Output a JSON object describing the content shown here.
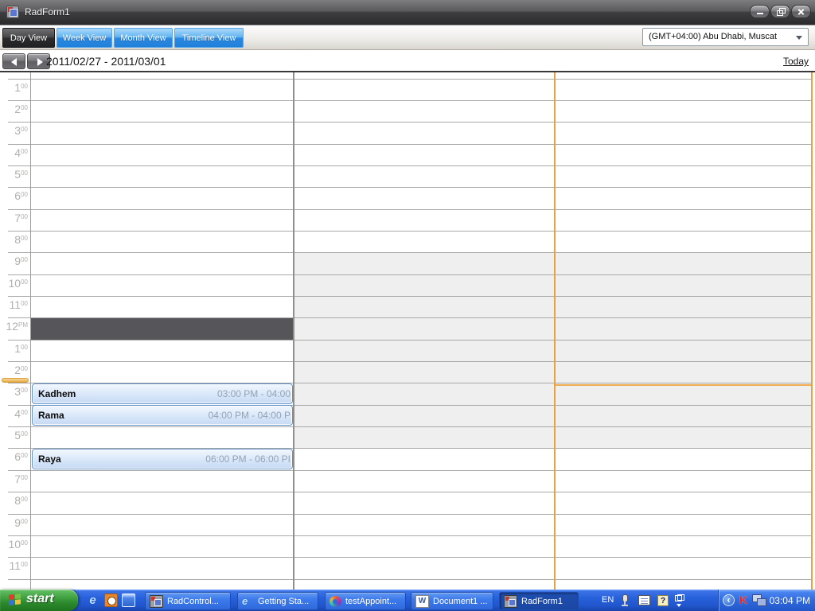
{
  "window": {
    "title": "RadForm1"
  },
  "toolbar": {
    "views": [
      {
        "label": "Day View",
        "active": true
      },
      {
        "label": "Week View",
        "active": false
      },
      {
        "label": "Month View",
        "active": false
      },
      {
        "label": "Timeline View",
        "active": false
      }
    ],
    "timezone": "(GMT+04:00) Abu Dhabi, Muscat"
  },
  "nav": {
    "date_range": "2011/02/27 - 2011/03/01",
    "today_label": "Today"
  },
  "scheduler": {
    "hours": [
      {
        "n": "1",
        "s": "00"
      },
      {
        "n": "2",
        "s": "00"
      },
      {
        "n": "3",
        "s": "00"
      },
      {
        "n": "4",
        "s": "00"
      },
      {
        "n": "5",
        "s": "00"
      },
      {
        "n": "6",
        "s": "00"
      },
      {
        "n": "7",
        "s": "00"
      },
      {
        "n": "8",
        "s": "00"
      },
      {
        "n": "9",
        "s": "00"
      },
      {
        "n": "10",
        "s": "00"
      },
      {
        "n": "11",
        "s": "00"
      },
      {
        "n": "12",
        "s": "PM"
      },
      {
        "n": "1",
        "s": "00"
      },
      {
        "n": "2",
        "s": "00"
      },
      {
        "n": "3",
        "s": "00"
      },
      {
        "n": "4",
        "s": "00"
      },
      {
        "n": "5",
        "s": "00"
      },
      {
        "n": "6",
        "s": "00"
      },
      {
        "n": "7",
        "s": "00"
      },
      {
        "n": "8",
        "s": "00"
      },
      {
        "n": "9",
        "s": "00"
      },
      {
        "n": "10",
        "s": "00"
      },
      {
        "n": "11",
        "s": "00"
      }
    ],
    "appointments": [
      {
        "name": "Kadhem",
        "time": "03:00 PM - 04:00"
      },
      {
        "name": "Rama",
        "time": "04:00 PM - 04:00 P"
      },
      {
        "name": "Raya",
        "time": "06:00 PM - 06:00 PI"
      }
    ]
  },
  "taskbar": {
    "start_label": "start",
    "tasks": [
      {
        "label": "RadControl..."
      },
      {
        "label": "Getting Sta..."
      },
      {
        "label": "testAppoint..."
      },
      {
        "label": "Document1 ..."
      },
      {
        "label": "RadForm1",
        "active": true
      }
    ],
    "language": "EN",
    "clock": "03:04 PM",
    "icons": {
      "ie_glyph": "e",
      "word_glyph": "W",
      "help_glyph": "?",
      "kaspersky_glyph": "K",
      "chevron_glyph": "‹"
    }
  },
  "colors": {
    "titlebar_gray": "#454548",
    "view_button_blue": "#2A87E0",
    "selected_view_dark": "#2D2D2F",
    "selected_cell": "#55555A",
    "offhours_shade": "#EFEFEF",
    "today_border_orange": "#E5A43E",
    "appointment_border": "#6090C8",
    "appointment_fill": "#DDEAFA",
    "taskbar_blue": "#2660DA",
    "pressed_task_blue": "#1C48A4",
    "start_green": "#2D8B2D"
  }
}
